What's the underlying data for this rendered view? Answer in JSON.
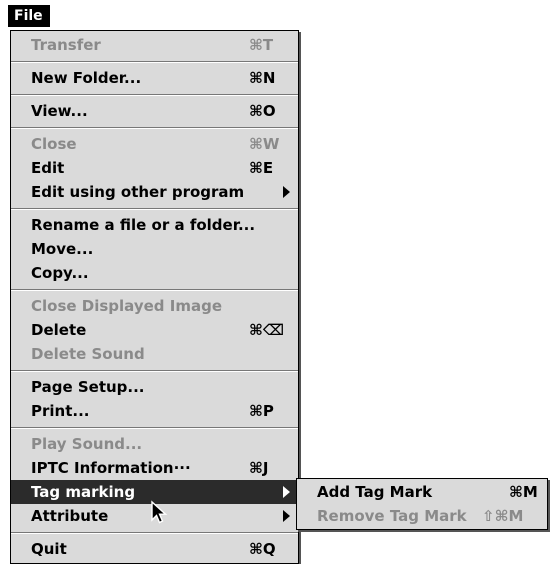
{
  "menubar": {
    "title": "File"
  },
  "menu": {
    "items": [
      {
        "label": "Transfer",
        "shortcut": "⌘T",
        "disabled": true
      },
      {
        "label": "New Folder...",
        "shortcut": "⌘N"
      },
      {
        "label": "View...",
        "shortcut": "⌘O"
      },
      {
        "label": "Close",
        "shortcut": "⌘W",
        "disabled": true
      },
      {
        "label": "Edit",
        "shortcut": "⌘E"
      },
      {
        "label": "Edit using other program",
        "submenu": true
      },
      {
        "label": "Rename a file or a folder..."
      },
      {
        "label": "Move..."
      },
      {
        "label": "Copy..."
      },
      {
        "label": "Close Displayed Image",
        "disabled": true
      },
      {
        "label": "Delete",
        "shortcut": "⌘⌫"
      },
      {
        "label": "Delete Sound",
        "disabled": true
      },
      {
        "label": "Page Setup..."
      },
      {
        "label": "Print...",
        "shortcut": "⌘P"
      },
      {
        "label": "Play Sound...",
        "disabled": true
      },
      {
        "label": "IPTC Information···",
        "shortcut": "⌘J"
      },
      {
        "label": "Tag marking",
        "submenu": true,
        "highlighted": true
      },
      {
        "label": "Attribute",
        "submenu": true
      },
      {
        "label": "Quit",
        "shortcut": "⌘Q"
      }
    ]
  },
  "submenu": {
    "items": [
      {
        "label": "Add Tag Mark",
        "shortcut": "⌘M"
      },
      {
        "label": "Remove Tag Mark",
        "shortcut": "⇧⌘M",
        "disabled": true
      }
    ]
  },
  "colors": {
    "menu_bg": "#dadada",
    "highlight": "#2b2b2b",
    "disabled_text": "#8a8a8a"
  }
}
